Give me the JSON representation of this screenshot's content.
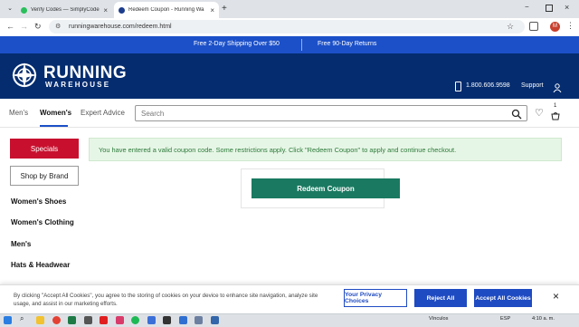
{
  "browser": {
    "tabs": [
      {
        "title": "Verify Codes — SimplyCodes",
        "favicon_color": "#2bbf5c"
      },
      {
        "title": "Redeem Coupon - Running Wa",
        "favicon_color": "#1c3d8c"
      }
    ],
    "url": "runningwarehouse.com/redeem.html",
    "profile_initial": "M"
  },
  "promo": {
    "shipping": "Free 2-Day Shipping Over $50",
    "returns": "Free 90-Day Returns"
  },
  "header": {
    "logo_line1": "RUNNING",
    "logo_line2": "WAREHOUSE",
    "phone": "1.800.606.9598",
    "support": "Support"
  },
  "nav": {
    "mens": "Men's",
    "womens": "Women's",
    "expert": "Expert Advice",
    "search_placeholder": "Search",
    "cart_count": "1"
  },
  "sidebar": {
    "specials": "Specials",
    "shop_by_brand": "Shop by Brand",
    "links": [
      "Women's Shoes",
      "Women's Clothing",
      "Men's",
      "Hats & Headwear"
    ]
  },
  "main": {
    "alert": "You have entered a valid coupon code. Some restrictions apply. Click \"Redeem Coupon\" to apply and continue checkout.",
    "redeem_button": "Redeem Coupon"
  },
  "cookie": {
    "text": "By clicking \"Accept All Cookies\", you agree to the storing of cookies on your device to enhance site navigation, analyze site usage, and assist in our marketing efforts.",
    "privacy": "Your Privacy Choices",
    "reject": "Reject All",
    "accept": "Accept All Cookies"
  },
  "taskbar": {
    "vinculos": "Vínculos",
    "lang": "ESP",
    "time": "4:10 a. m."
  },
  "colors": {
    "promo_bar": "#1c50c8",
    "header": "#042c6f",
    "specials": "#c8102e",
    "redeem": "#1a7a61",
    "cookie_buttons": "#1f4bc2"
  }
}
